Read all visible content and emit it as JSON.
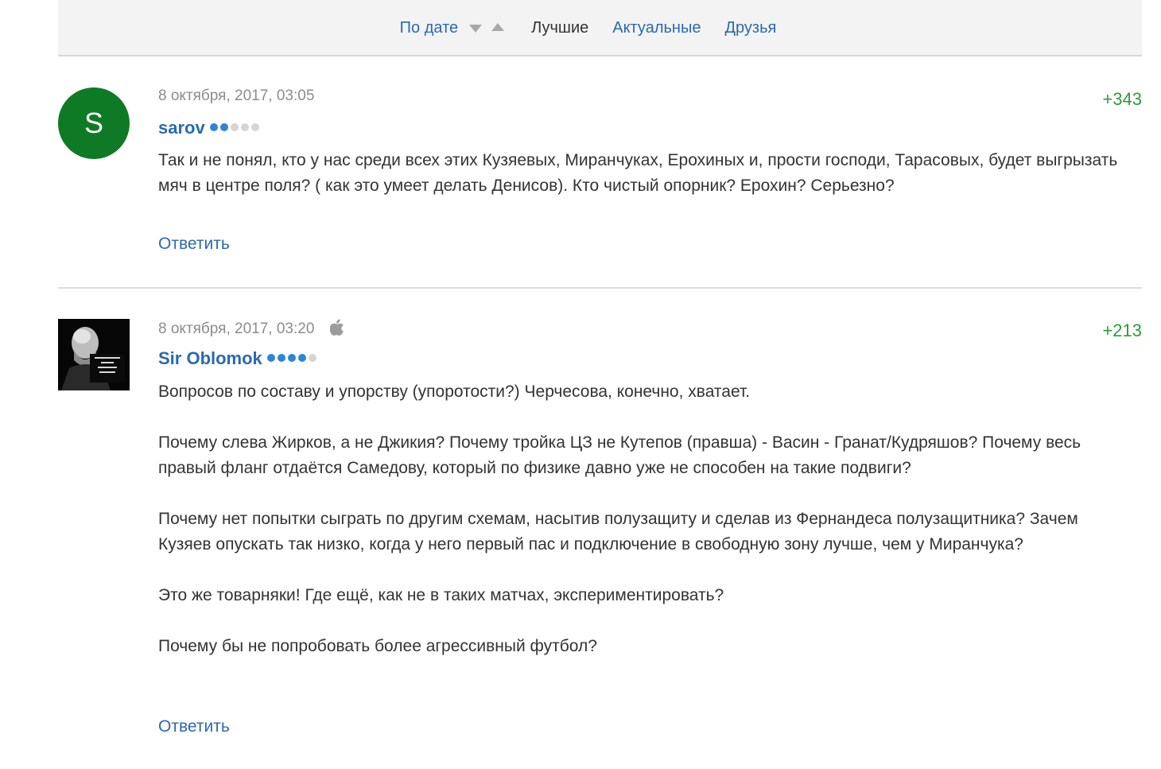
{
  "sort": {
    "by_date": "По дате",
    "best": "Лучшие",
    "actual": "Актуальные",
    "friends": "Друзья"
  },
  "comments": [
    {
      "avatar_letter": "S",
      "date": "8 октября, 2017, 03:05",
      "rating": "+343",
      "username": "sarov",
      "level": 2,
      "level_max": 5,
      "paragraphs": [
        "Так и не понял, кто у нас среди всех этих Кузяевых, Миранчуках, Ерохиных и, прости господи, Тарасовых, будет выгрызать мяч в центре поля? ( как это умеет делать Денисов). Кто чистый опорник? Ерохин? Серьезно?"
      ],
      "reply": "Ответить"
    },
    {
      "avatar_icon": "lenin-portrait-avatar",
      "date": "8 октября, 2017, 03:20",
      "device_icon": "apple-icon",
      "rating": "+213",
      "username": "Sir Oblomok",
      "level": 4,
      "level_max": 5,
      "paragraphs": [
        "Вопросов по составу и упорству (упоротости?) Черчесова, конечно, хватает.",
        "Почему слева Жирков, а не Джикия? Почему тройка ЦЗ не Кутепов (правша) - Васин - Гранат/Кудряшов? Почему весь правый фланг отдаётся Самедову, который по физике давно уже не способен на такие подвиги?",
        "Почему нет попытки сыграть по другим схемам, насытив полузащиту и сделав из Фернандеса полузащитника? Зачем Кузяев опускать так низко, когда у него первый пас и подключение в свободную зону лучше, чем у Миранчука?",
        "Это же товарняки! Где ещё, как не в таких матчах, экспериментировать?",
        "Почему бы не попробовать более агрессивный футбол?"
      ],
      "reply": "Ответить"
    }
  ],
  "colors": {
    "link": "#2a6ab0",
    "rating": "#2e9c3a",
    "avatar_bg": "#0f7a25",
    "level_on": "#2b86d6",
    "level_off": "#d5d5d5"
  }
}
